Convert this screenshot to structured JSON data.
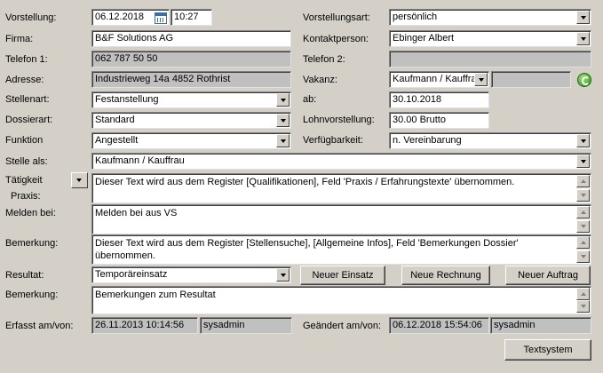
{
  "labels": {
    "vorstellung": "Vorstellung:",
    "firma": "Firma:",
    "telefon1": "Telefon 1:",
    "adresse": "Adresse:",
    "stellenart": "Stellenart:",
    "dossierart": "Dossierart:",
    "funktion": "Funktion",
    "stelle_als": "Stelle als:",
    "taetigkeit": "Tätigkeit",
    "praxis": "Praxis:",
    "melden_bei": "Melden bei:",
    "bemerkung": "Bemerkung:",
    "resultat": "Resultat:",
    "bemerkung2": "Bemerkung:",
    "erfasst": "Erfasst am/von:",
    "vorstellungsart": "Vorstellungsart:",
    "kontaktperson": "Kontaktperson:",
    "telefon2": "Telefon 2:",
    "vakanz": "Vakanz:",
    "ab": "ab:",
    "lohnvorstellung": "Lohnvorstellung:",
    "verfuegbarkeit": "Verfügbarkeit:",
    "geaendert": "Geändert am/von:"
  },
  "fields": {
    "vorstellung_date": "06.12.2018",
    "vorstellung_time": "10:27",
    "firma": "B&F Solutions AG",
    "telefon1": "062 787 50 50",
    "adresse": "Industrieweg 14a 4852 Rothrist",
    "stellenart": "Festanstellung",
    "dossierart": "Standard",
    "funktion": "Angestellt",
    "stelle_als": "Kaufmann / Kauffrau",
    "taetigkeit_text": "Dieser Text wird aus dem Register [Qualifikationen], Feld 'Praxis / Erfahrungstexte' übernommen.",
    "melden_bei_text": "Melden bei aus VS",
    "bemerkung_text": "Dieser Text wird aus dem Register [Stellensuche], [Allgemeine Infos], Feld 'Bemerkungen Dossier' übernommen.",
    "resultat": "Temporäreinsatz",
    "bemerkung_resultat": "Bemerkungen zum Resultat",
    "erfasst_am": "26.11.2013 10:14:56",
    "erfasst_von": "sysadmin",
    "vorstellungsart": "persönlich",
    "kontaktperson": "Ebinger Albert",
    "telefon2": "",
    "vakanz": "Kaufmann / Kauffra",
    "ab": "30.10.2018",
    "lohnvorstellung": "30.00 Brutto",
    "verfuegbarkeit": "n. Vereinbarung",
    "geaendert_am": "06.12.2018 15:54:06",
    "geaendert_von": "sysadmin"
  },
  "buttons": {
    "neuer_einsatz": "Neuer Einsatz",
    "neue_rechnung": "Neue Rechnung",
    "neuer_auftrag": "Neuer Auftrag",
    "textsystem": "Textsystem"
  }
}
